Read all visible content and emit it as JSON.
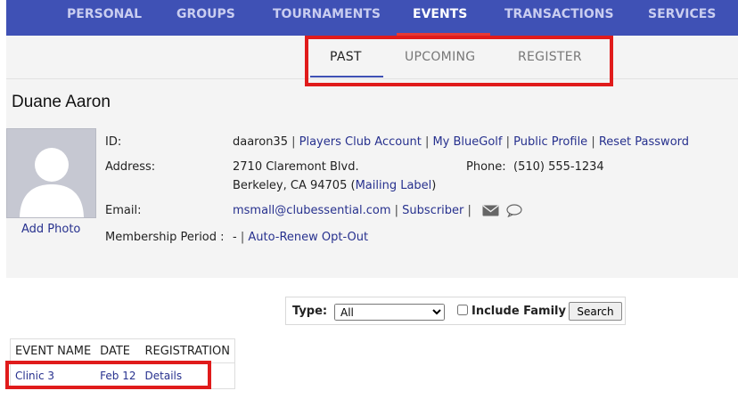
{
  "topnav": {
    "items": [
      {
        "label": "PERSONAL"
      },
      {
        "label": "GROUPS"
      },
      {
        "label": "TOURNAMENTS"
      },
      {
        "label": "EVENTS"
      },
      {
        "label": "TRANSACTIONS"
      },
      {
        "label": "SERVICES"
      }
    ],
    "active": "EVENTS",
    "active_underline_color": "#e53935",
    "background": "#3f51b5"
  },
  "subtabs": {
    "items": [
      {
        "label": "PAST"
      },
      {
        "label": "UPCOMING"
      },
      {
        "label": "REGISTER"
      }
    ],
    "active": "PAST"
  },
  "member": {
    "name": "Duane Aaron",
    "add_photo": "Add Photo",
    "id_label": "ID:",
    "id_value": "daaron35",
    "id_links": [
      "Players Club Account",
      "My BlueGolf",
      "Public Profile",
      "Reset Password"
    ],
    "address_label": "Address:",
    "address_line1": "2710 Claremont Blvd.",
    "address_line2": "Berkeley, CA 94705",
    "mailing_label_link": "Mailing Label",
    "phone_label": "Phone:",
    "phone_value": "(510) 555-1234",
    "email_label": "Email:",
    "email_value": "msmall@clubessential.com",
    "subscriber_link": "Subscriber",
    "membership_label": "Membership Period :",
    "membership_value": "-",
    "auto_renew_link": "Auto-Renew Opt-Out",
    "envelope_icon": "envelope-icon",
    "chat_icon": "chat-bubble-icon"
  },
  "filter": {
    "type_label": "Type:",
    "type_selected": "All",
    "include_family_label": "Include Family",
    "include_family_checked": false,
    "search_label": "Search"
  },
  "events_table": {
    "columns": [
      "EVENT NAME",
      "DATE",
      "REGISTRATION"
    ],
    "rows": [
      {
        "name": "Clinic 3",
        "date": "Feb 12",
        "registration": "Details"
      }
    ]
  },
  "highlight_color": "#e01b1b"
}
